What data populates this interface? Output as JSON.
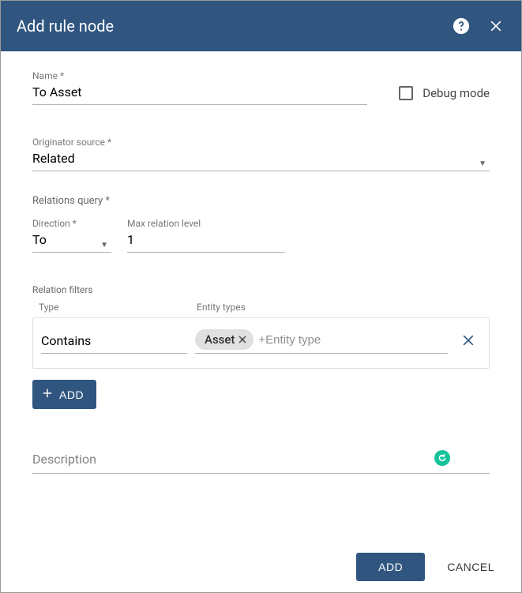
{
  "header": {
    "title": "Add rule node"
  },
  "name": {
    "label": "Name *",
    "value": "To Asset"
  },
  "debug": {
    "label": "Debug mode",
    "checked": false
  },
  "originator": {
    "label": "Originator source *",
    "value": "Related"
  },
  "relations_query": {
    "label": "Relations query *",
    "direction": {
      "label": "Direction *",
      "value": "To"
    },
    "max_level": {
      "label": "Max relation level",
      "value": "1"
    }
  },
  "relation_filters": {
    "label": "Relation filters",
    "head_type": "Type",
    "head_entity": "Entity types",
    "rows": [
      {
        "type": "Contains",
        "chips": [
          "Asset"
        ],
        "placeholder": "+Entity type"
      }
    ],
    "add_label": "ADD"
  },
  "description": {
    "placeholder": "Description"
  },
  "footer": {
    "ok": "ADD",
    "cancel": "CANCEL"
  }
}
